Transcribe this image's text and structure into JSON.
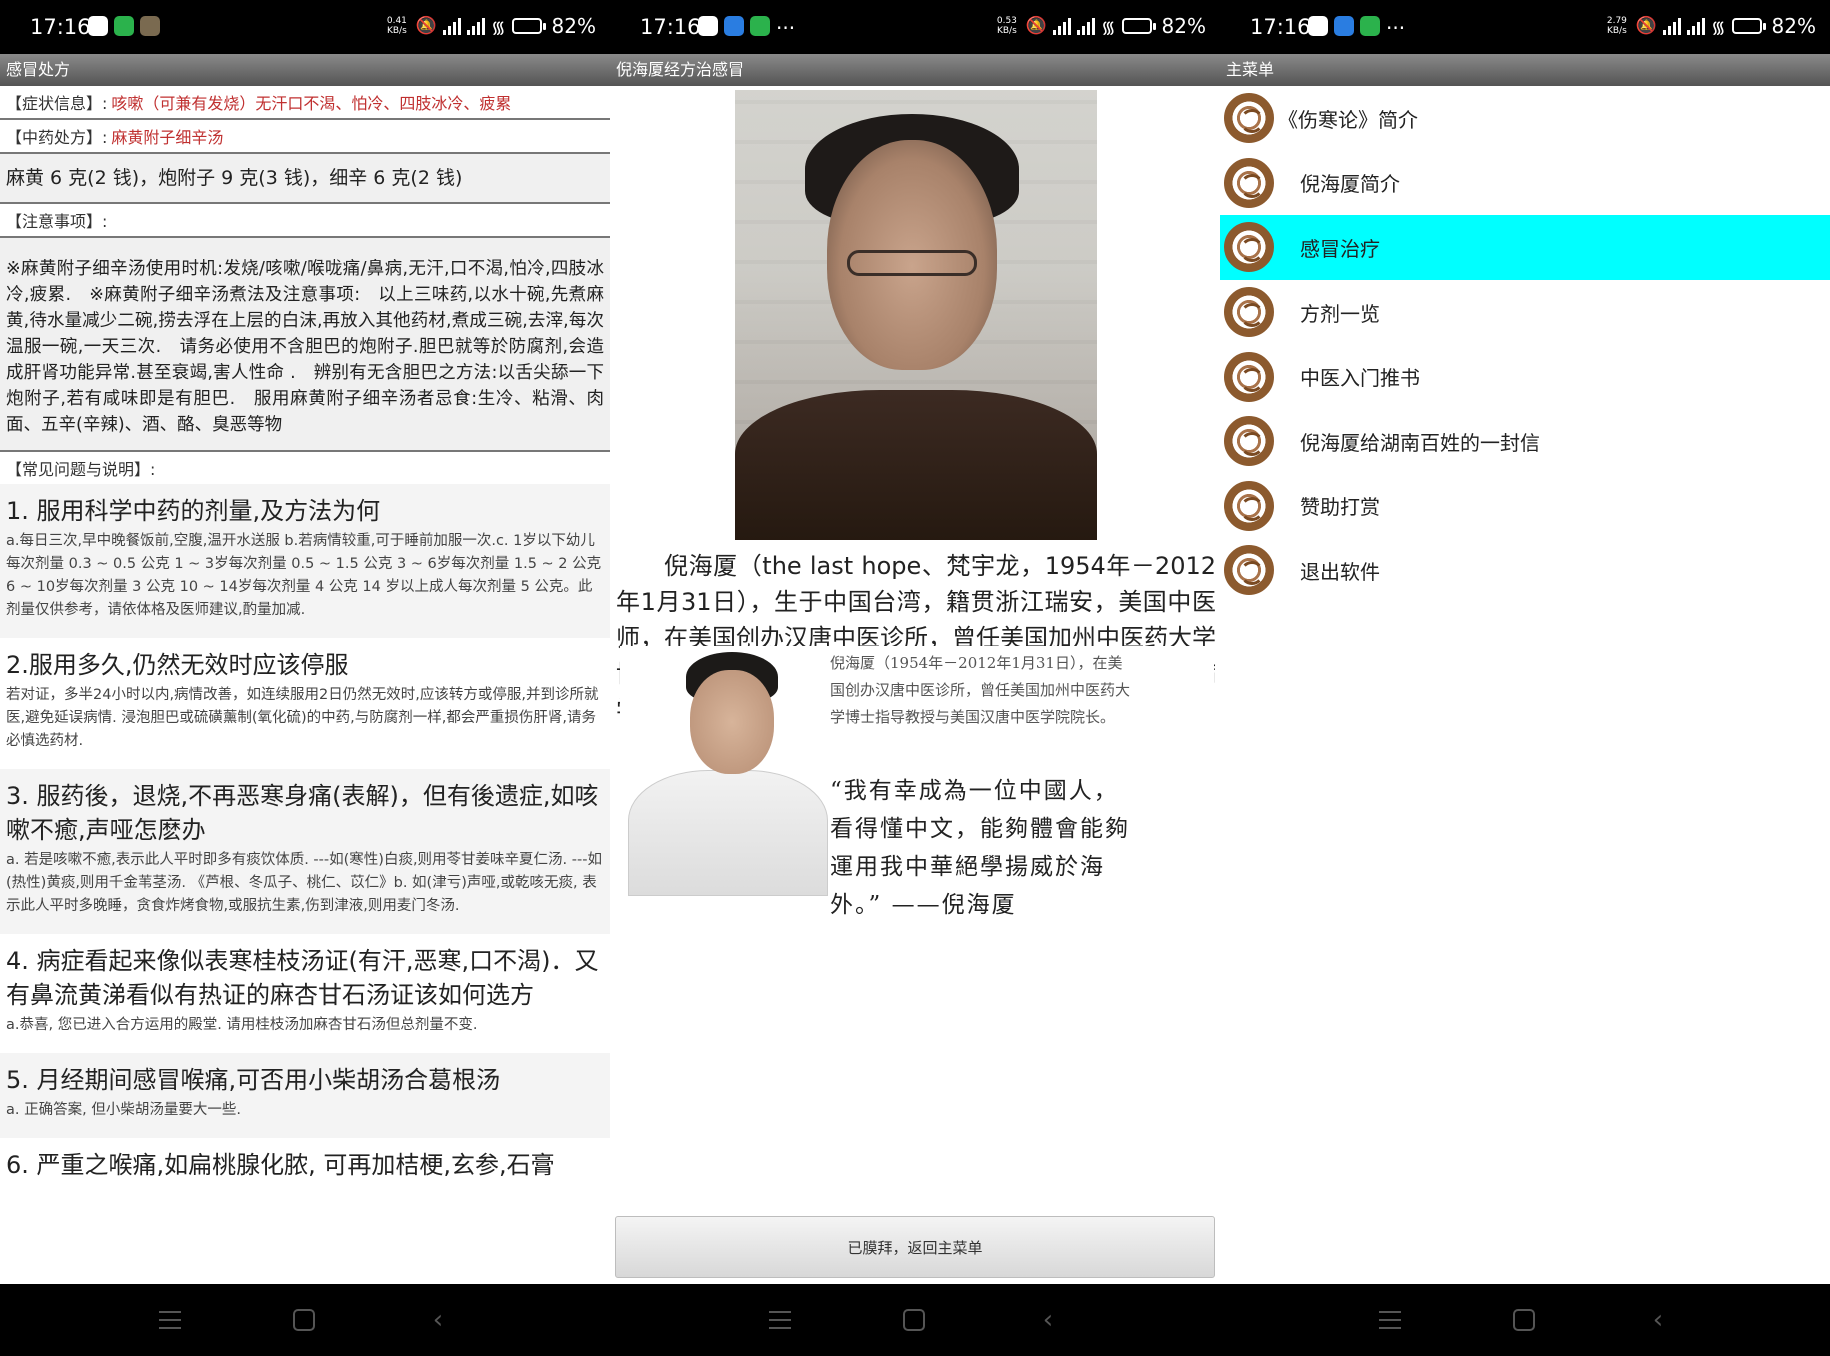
{
  "status": {
    "time": "17:16",
    "battery_pct": "82",
    "battery_unit": "%",
    "speed_unit": "KB/s",
    "speeds": [
      "0.41",
      "0.53",
      "2.79"
    ],
    "more": "···"
  },
  "screen1": {
    "title": "感冒处方",
    "symptom_label": "【症状信息】:",
    "symptom_value": "咳嗽（可兼有发烧）无汗口不渴、怕冷、四肢冰冷、疲累",
    "formula_label": "【中药处方】:",
    "formula_value": "麻黄附子细辛汤",
    "dosage": "麻黄 6 克(2 钱)，炮附子 9 克(3 钱)，细辛 6 克(2 钱)",
    "notes_label": "【注意事项】:",
    "notes": "※麻黄附子细辛汤使用时机:发烧/咳嗽/喉咙痛/鼻病,无汗,口不渴,怕冷,四肢冰冷,疲累.　※麻黄附子细辛汤煮法及注意事项:　以上三味药,以水十碗,先煮麻黄,待水量减少二碗,捞去浮在上层的白沫,再放入其他药材,煮成三碗,去滓,每次温服一碗,一天三次.　请务必使用不含胆巴的炮附子.胆巴就等於防腐剂,会造成肝肾功能异常.甚至衰竭,害人性命 .　辨别有无含胆巴之方法:以舌尖舔一下炮附子,若有咸味即是有胆巴.　服用麻黄附子细辛汤者忌食:生冷、粘滑、肉面、五辛(辛辣)、酒、酪、臭恶等物",
    "faq_label": "【常见问题与说明】:",
    "faq": [
      {
        "q": "1. 服用科学中药的剂量,及方法为何",
        "a": "a.每日三次,早中晚餐饭前,空腹,温开水送服 b.若病情较重,可于睡前加服一次.c. 1岁以下幼儿每次剂量 0.3 ~ 0.5 公克 1 ~ 3岁每次剂量 0.5 ~ 1.5 公克 3 ~ 6岁每次剂量 1.5 ~ 2 公克 6 ~ 10岁每次剂量 3 公克 10 ~ 14岁每次剂量 4 公克 14 岁以上成人每次剂量 5 公克。此剂量仅供参考，请依体格及医师建议,酌量加减."
      },
      {
        "q": "2.服用多久,仍然无效时应该停服",
        "a": "若对证，多半24小时以内,病情改善，如连续服用2日仍然无效时,应该转方或停服,并到诊所就医,避免延误病情. 浸泡胆巴或硫磺薰制(氧化硫)的中药,与防腐剂一样,都会严重损伤肝肾,请务必慎选药材."
      },
      {
        "q": "3. 服药後，退烧,不再恶寒身痛(表解)，但有後遗症,如咳嗽不癒,声哑怎麽办",
        "a": "a. 若是咳嗽不癒,表示此人平时即多有痰饮体质. ---如(寒性)白痰,则用苓甘姜味辛夏仁汤. ---如(热性)黄痰,则用千金苇茎汤. 《芦根、冬瓜子、桃仁、苡仁》b. 如(津亏)声哑,或乾咳无痰, 表示此人平时多晚睡，贪食炸烤食物,或服抗生素,伤到津液,则用麦门冬汤."
      },
      {
        "q": "4. 病症看起来像似表寒桂枝汤证(有汗,恶寒,口不渴)．又有鼻流黄涕看似有热证的麻杏甘石汤证该如何选方",
        "a": "a.恭喜, 您已进入合方运用的殿堂. 请用桂枝汤加麻杏甘石汤但总剂量不变."
      },
      {
        "q": "5. 月经期间感冒喉痛,可否用小柴胡汤合葛根汤",
        "a": "a. 正确答案, 但小柴胡汤量要大一些."
      },
      {
        "q": "6. 严重之喉痛,如扁桃腺化脓, 可再加桔梗,玄参,石膏",
        "a": ""
      }
    ]
  },
  "screen2": {
    "title": "倪海厦经方治感冒",
    "bio": "倪海厦（the last hope、梵宇龙，1954年－2012年1月31日），生于中国台湾，籍贯浙江瑞安，美国中医师，在美国创办汉唐中医诊所，曾任美国加州中医药大学博士指导教授与美国汉唐中医学院院长。因强烈批判温病学派与西方医学引起一些争议。",
    "caption": "倪海厦（1954年－2012年1月31日），在美国创办汉唐中医诊所，曾任美国加州中医药大学博士指导教授与美国汉唐中医学院院长。",
    "quote": "“我有幸成為一位中國人，看得懂中文，能夠體會能夠運用我中華絕學揚威於海外。” ——倪海厦",
    "back_button": "已膜拜，返回主菜单"
  },
  "screen3": {
    "title": "主菜单",
    "items": [
      {
        "label": "《伤寒论》简介",
        "active": false
      },
      {
        "label": "倪海厦简介",
        "active": false
      },
      {
        "label": "感冒治疗",
        "active": true
      },
      {
        "label": "方剂一览",
        "active": false
      },
      {
        "label": "中医入门推书",
        "active": false
      },
      {
        "label": "倪海厦给湖南百姓的一封信",
        "active": false
      },
      {
        "label": "赞助打赏",
        "active": false
      },
      {
        "label": "退出软件",
        "active": false
      }
    ]
  },
  "colors": {
    "highlight": "#00ffff",
    "red_text": "#c03030",
    "titlebar": "#6e6e6e"
  }
}
